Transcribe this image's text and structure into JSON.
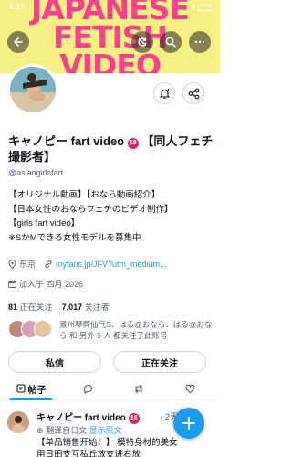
{
  "status_bar": {
    "time": "1:15"
  },
  "banner": {
    "line1": "JAPANESE",
    "line2": "FETISH",
    "line3": "VIDEO",
    "bg_color": "#f6ef84",
    "text_color": "#ff3f8e"
  },
  "header_icons": [
    "back-arrow-icon",
    "refresh-icon",
    "search-icon",
    "more-icon"
  ],
  "profile": {
    "name": "キャノピー fart video",
    "name_suffix": "【同人フェチ撮影者】",
    "age_badge": "18",
    "handle": "@asiangirlsfart",
    "bio": [
      "【オリジナル動画】【おなら動画紹介】",
      "【日本女性のおならフェチのビデオ制作】",
      "【girls fart video】",
      "※SかMできる女性モデルを募集中"
    ],
    "location": "东京",
    "website": "myfans.jp/JFV?utm_medium...",
    "joined": "加入于 四月 2026"
  },
  "stats": {
    "following_count": "81",
    "following_label": "正在关注",
    "followers_count": "7,017",
    "followers_label": "关注者"
  },
  "followed_by": "景州琴葬仙气S、はる@おなら、はる@おなら 和 另外 6 人 都关注了此账号",
  "buttons": {
    "message": "私信",
    "following": "正在关注"
  },
  "tabs": [
    {
      "label": "帖子",
      "icon": "posts-icon"
    },
    {
      "icon": "reply-icon"
    },
    {
      "icon": "repost-icon"
    },
    {
      "icon": "heart-icon"
    }
  ],
  "tweet": {
    "name": "キャノピー fart video",
    "age_badge": "18",
    "time": "· 2天",
    "translate_prefix": "翻译自日文",
    "translate_link": "显示原文",
    "text": "【单品销售开始！】 模特身材的美女",
    "text2": "用日田支互私丘放支进右放"
  },
  "colors": {
    "accent": "#1d9bf0",
    "secondary_text": "#536471",
    "border": "#cfd9de"
  }
}
